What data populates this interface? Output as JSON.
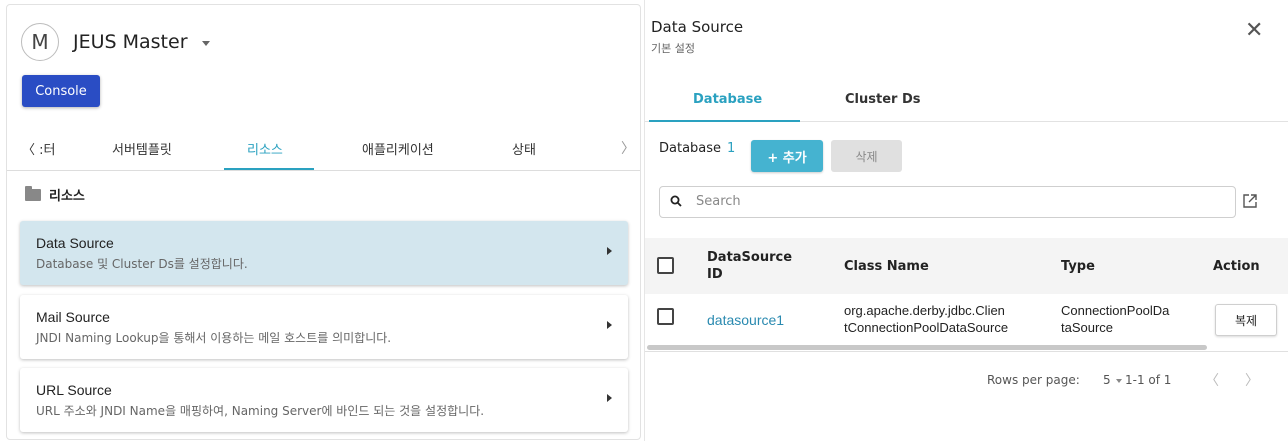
{
  "left_panel": {
    "avatar_letter": "M",
    "server_name": "JEUS Master",
    "console_label": "Console",
    "tabs": [
      {
        "label": "〈 :터"
      },
      {
        "label": "서버템플릿"
      },
      {
        "label": "리소스",
        "active": true
      },
      {
        "label": "애플리케이션"
      },
      {
        "label": "상태"
      }
    ],
    "tab_next": "〉",
    "section_title": "리소스",
    "cards": [
      {
        "title": "Data Source",
        "desc": "Database 및 Cluster Ds를 설정합니다.",
        "active": true
      },
      {
        "title": "Mail Source",
        "desc": "JNDI Naming Lookup을 통해서 이용하는 메일 호스트를 의미합니다."
      },
      {
        "title": "URL Source",
        "desc": "URL 주소와 JNDI Name을 매핑하여, Naming Server에 바인드 되는 것을 설정합니다."
      }
    ]
  },
  "right_panel": {
    "title": "Data Source",
    "subtitle": "기본 설정",
    "close_symbol": "✕",
    "tabs": [
      {
        "label": "Database",
        "active": true
      },
      {
        "label": "Cluster Ds"
      }
    ],
    "db_label": "Database",
    "db_count": "1",
    "add_label": "+ 추가",
    "delete_label": "삭제",
    "search": {
      "placeholder": "Search"
    },
    "table": {
      "headers": {
        "id_line1": "DataSource",
        "id_line2": "ID",
        "class_name": "Class Name",
        "type": "Type",
        "action": "Action"
      },
      "rows": [
        {
          "id": "datasource1",
          "class_line1": "org.apache.derby.jdbc.Clien",
          "class_line2": "tConnectionPoolDataSource",
          "type_line1": "ConnectionPoolDa",
          "type_line2": "taSource",
          "action": "복제"
        }
      ]
    },
    "pager": {
      "rows_per_page_label": "Rows per page:",
      "rows_per_page_value": "5",
      "range": "1-1 of 1",
      "prev": "〈",
      "next": "〉"
    }
  },
  "colors": {
    "accent": "#2aa1c0",
    "console": "#2a4dc4",
    "active_card": "#d3e6ee",
    "add_button": "#45b3d0"
  }
}
